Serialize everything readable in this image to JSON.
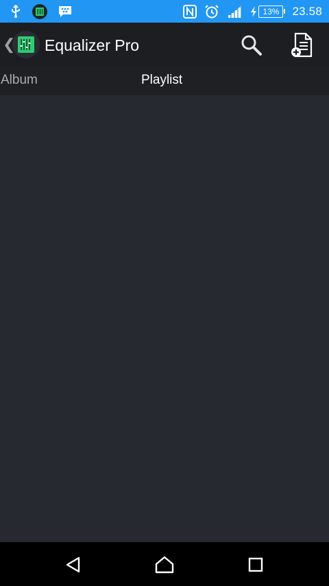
{
  "status_bar": {
    "left_icons": [
      "usb-icon",
      "equalizer-notification-icon",
      "bbm-icon"
    ],
    "right_icons": [
      "nfc-icon",
      "alarm-icon",
      "signal-icon",
      "charging-icon"
    ],
    "battery_percent": "13%",
    "time": "23.58",
    "background_color": "#2196f3"
  },
  "app_bar": {
    "title": "Equalizer Pro",
    "logo_color": "#2ecc71",
    "actions": [
      "search-icon",
      "new-playlist-icon"
    ]
  },
  "tabs": [
    {
      "label": "Album",
      "active": false
    },
    {
      "label": "Playlist",
      "active": true
    }
  ],
  "navigation": [
    "back",
    "home",
    "recents"
  ]
}
